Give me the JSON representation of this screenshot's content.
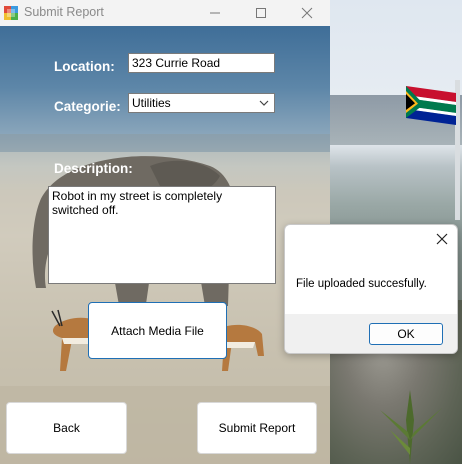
{
  "window": {
    "title": "Submit Report",
    "minimize_icon": "minimize-icon",
    "maximize_icon": "maximize-icon",
    "close_icon": "close-icon"
  },
  "form": {
    "location_label": "Location:",
    "location_value": "323 Currie Road",
    "category_label": "Categorie:",
    "category_value": "Utilities",
    "description_label": "Description:",
    "description_value": "Robot in my street is completely switched off.",
    "attach_button": "Attach Media File",
    "back_button": "Back",
    "submit_button": "Submit Report"
  },
  "dialog": {
    "message": "File uploaded succesfully.",
    "ok_button": "OK"
  },
  "colors": {
    "accent": "#1f6fb5",
    "label_text": "#ffffff"
  }
}
